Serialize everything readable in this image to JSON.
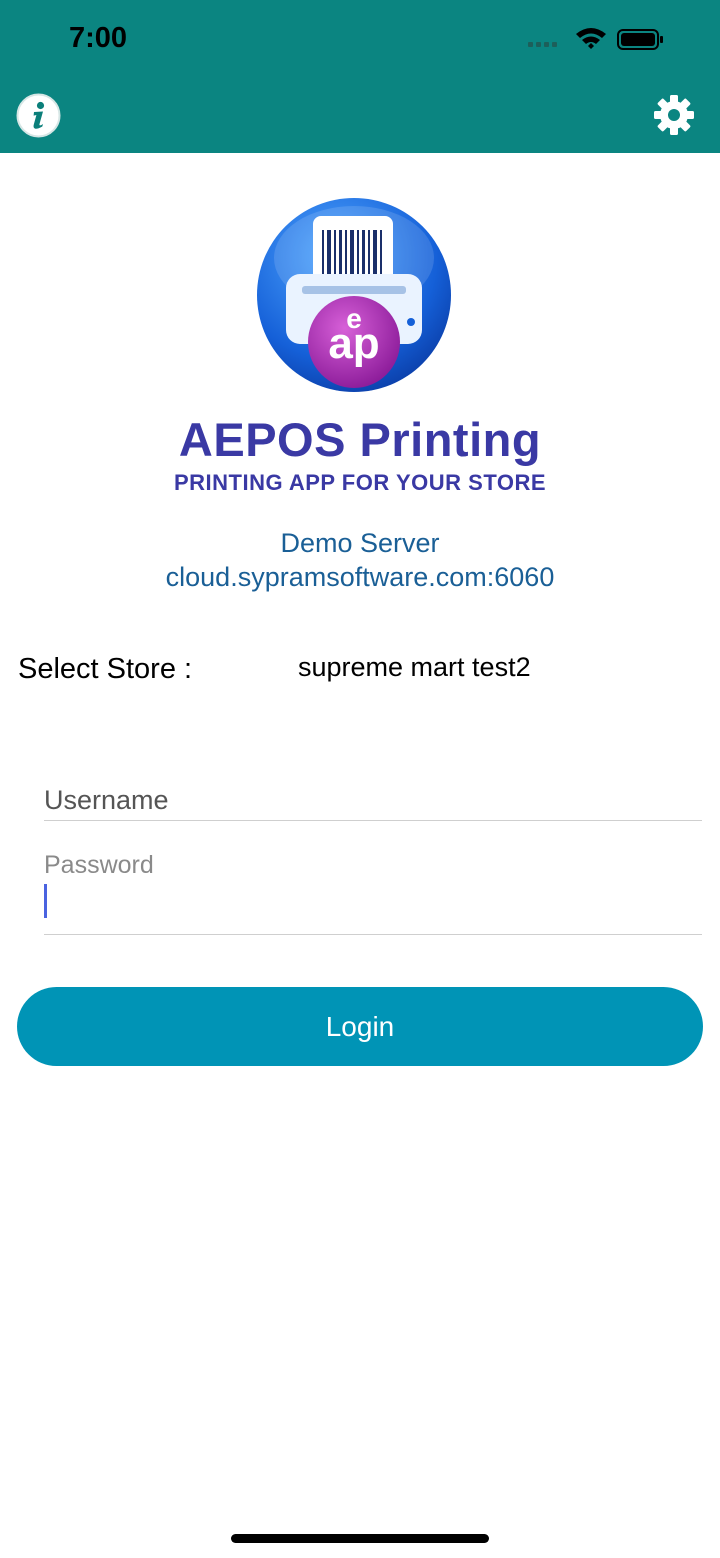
{
  "status_bar": {
    "time": "7:00"
  },
  "header": {
    "info_icon": "info-icon",
    "settings_icon": "gear-icon",
    "color": "#0b8581"
  },
  "brand": {
    "title": "AEPOS Printing",
    "tagline": "PRINTING APP FOR YOUR STORE",
    "color": "#3a39a4"
  },
  "server": {
    "name": "Demo Server",
    "url": "cloud.sypramsoftware.com:6060"
  },
  "store": {
    "label": "Select Store :",
    "value": "supreme mart test2"
  },
  "form": {
    "username_placeholder": "Username",
    "username_value": "",
    "password_label": "Password",
    "password_value": ""
  },
  "login": {
    "label": "Login",
    "color": "#0094b6"
  }
}
